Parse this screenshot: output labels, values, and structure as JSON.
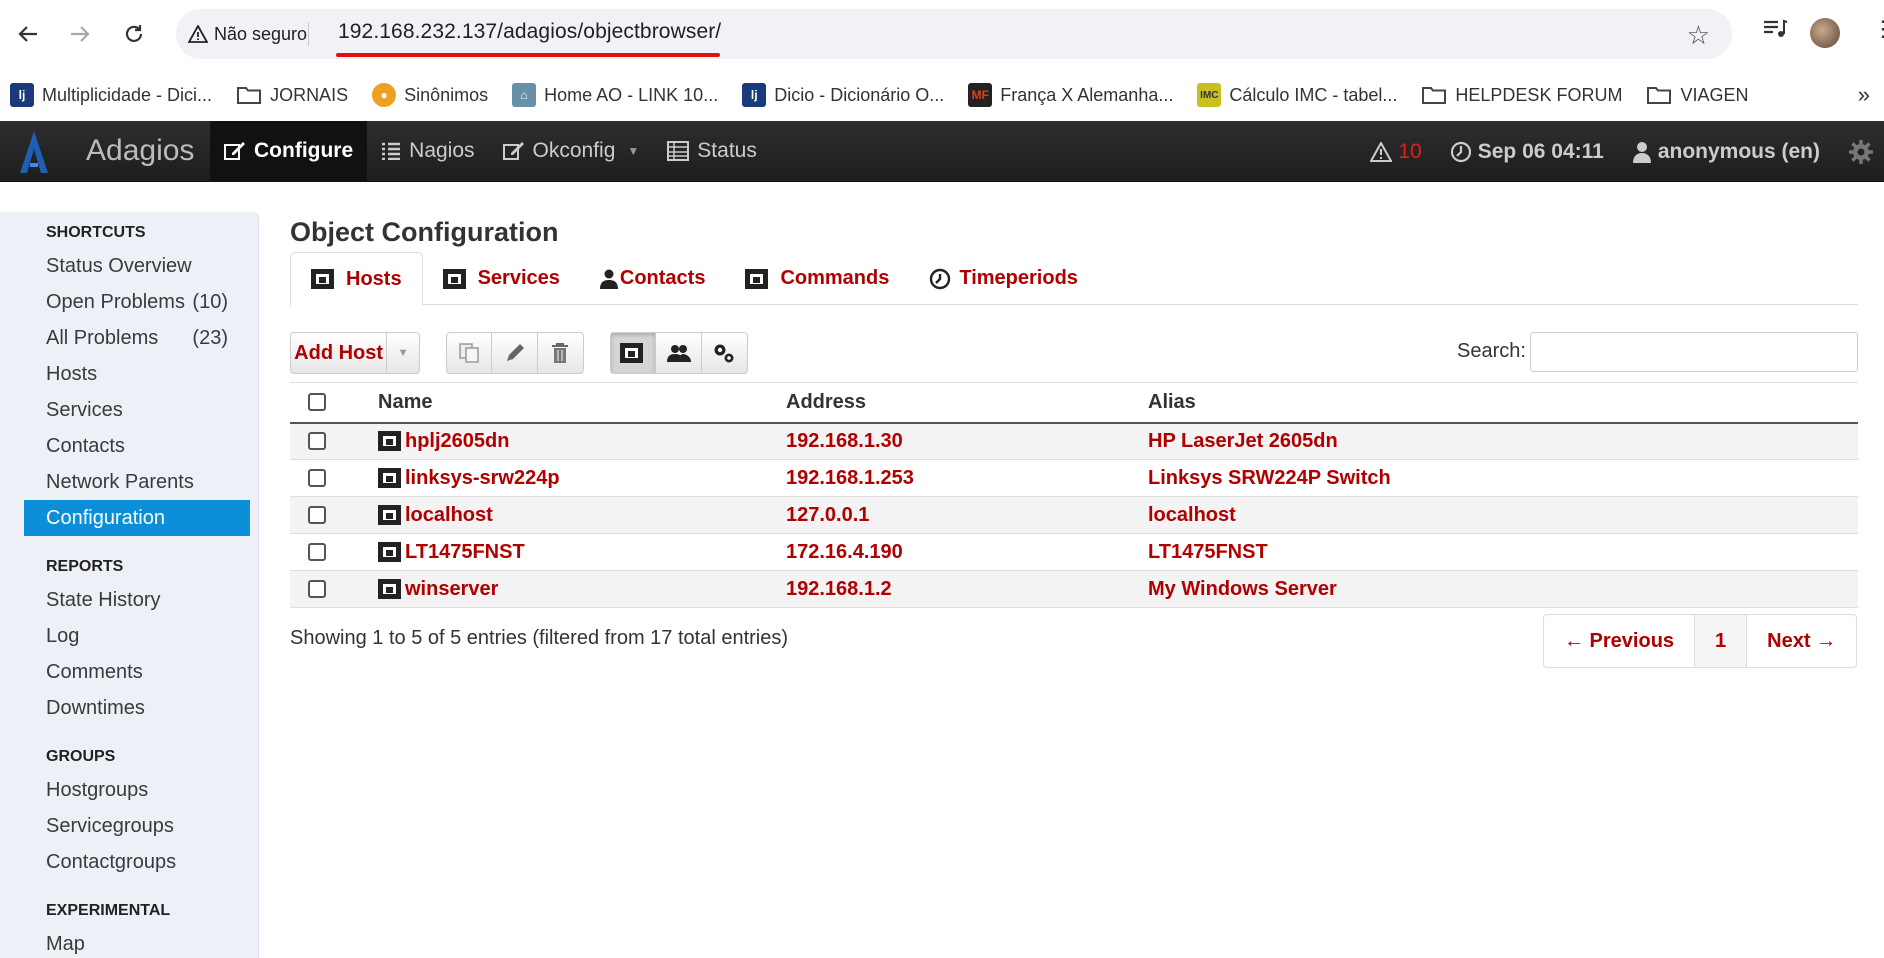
{
  "browser": {
    "security_label": "Não seguro",
    "url": "192.168.232.137/adagios/objectbrowser/",
    "bookmarks": [
      {
        "label": "Multiplicidade - Dici...",
        "icon": "dicio-favicon"
      },
      {
        "label": "JORNAIS",
        "icon": "folder-icon"
      },
      {
        "label": "Sinônimos",
        "icon": "sinonimos-favicon"
      },
      {
        "label": "Home AO - LINK 10...",
        "icon": "home-favicon"
      },
      {
        "label": "Dicio - Dicionário O...",
        "icon": "dicio-favicon"
      },
      {
        "label": "França X Alemanha...",
        "icon": "mf-favicon"
      },
      {
        "label": "Cálculo IMC - tabel...",
        "icon": "imc-favicon"
      },
      {
        "label": "HELPDESK FORUM",
        "icon": "folder-icon"
      },
      {
        "label": "VIAGEN",
        "icon": "folder-icon"
      }
    ]
  },
  "navbar": {
    "brand": "Adagios",
    "menu": [
      {
        "label": "Configure",
        "icon": "edit-icon",
        "active": true
      },
      {
        "label": "Nagios",
        "icon": "list-icon"
      },
      {
        "label": "Okconfig",
        "icon": "edit-icon",
        "dropdown": true
      },
      {
        "label": "Status",
        "icon": "table-icon"
      }
    ],
    "alerts_count": "10",
    "datetime": "Sep 06 04:11",
    "user": "anonymous (en)"
  },
  "sidebar": {
    "sections": [
      {
        "header": "SHORTCUTS",
        "items": [
          {
            "label": "Status Overview",
            "count": ""
          },
          {
            "label": "Open Problems",
            "count": "(10)"
          },
          {
            "label": "All Problems",
            "count": "(23)"
          },
          {
            "label": "Hosts",
            "count": ""
          },
          {
            "label": "Services",
            "count": ""
          },
          {
            "label": "Contacts",
            "count": ""
          },
          {
            "label": "Network Parents",
            "count": ""
          },
          {
            "label": "Configuration",
            "count": "",
            "selected": true
          }
        ]
      },
      {
        "header": "REPORTS",
        "items": [
          {
            "label": "State History",
            "count": ""
          },
          {
            "label": "Log",
            "count": ""
          },
          {
            "label": "Comments",
            "count": ""
          },
          {
            "label": "Downtimes",
            "count": ""
          }
        ]
      },
      {
        "header": "GROUPS",
        "items": [
          {
            "label": "Hostgroups",
            "count": ""
          },
          {
            "label": "Servicegroups",
            "count": ""
          },
          {
            "label": "Contactgroups",
            "count": ""
          }
        ]
      },
      {
        "header": "EXPERIMENTAL",
        "items": [
          {
            "label": "Map",
            "count": ""
          }
        ]
      }
    ]
  },
  "main": {
    "title": "Object Configuration",
    "tabs": [
      {
        "label": "Hosts",
        "icon": "host-icon",
        "active": true
      },
      {
        "label": "Services",
        "icon": "service-icon"
      },
      {
        "label": "Contacts",
        "icon": "contact-icon"
      },
      {
        "label": "Commands",
        "icon": "command-icon"
      },
      {
        "label": "Timeperiods",
        "icon": "clock-icon"
      }
    ],
    "add_button": "Add Host",
    "search_label": "Search:",
    "columns": [
      "Name",
      "Address",
      "Alias"
    ],
    "rows": [
      {
        "name": "hplj2605dn",
        "address": "192.168.1.30",
        "alias": "HP LaserJet 2605dn"
      },
      {
        "name": "linksys-srw224p",
        "address": "192.168.1.253",
        "alias": "Linksys SRW224P Switch"
      },
      {
        "name": "localhost",
        "address": "127.0.0.1",
        "alias": "localhost"
      },
      {
        "name": "LT1475FNST",
        "address": "172.16.4.190",
        "alias": "LT1475FNST"
      },
      {
        "name": "winserver",
        "address": "192.168.1.2",
        "alias": "My Windows Server"
      }
    ],
    "info": "Showing 1 to 5 of 5 entries (filtered from 17 total entries)",
    "pager": {
      "previous": "← Previous",
      "page": "1",
      "next": "Next →"
    }
  }
}
